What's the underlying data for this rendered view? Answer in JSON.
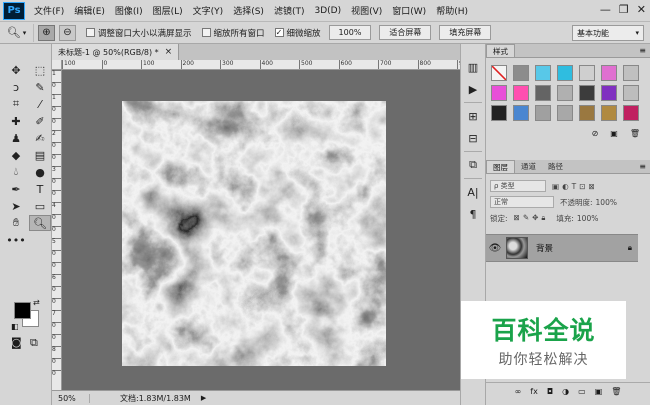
{
  "app": {
    "logo": "Ps"
  },
  "menu": [
    "文件(F)",
    "编辑(E)",
    "图像(I)",
    "图层(L)",
    "文字(Y)",
    "选择(S)",
    "滤镜(T)",
    "3D(D)",
    "视图(V)",
    "窗口(W)",
    "帮助(H)"
  ],
  "window_controls": {
    "minimize": "—",
    "restore": "❐",
    "close": "✕"
  },
  "options": {
    "tool_icon": "zoom-icon",
    "zoom_in": "⊕",
    "zoom_out": "⊖",
    "resize_windows": {
      "label": "调整窗口大小以满屏显示",
      "checked": false
    },
    "zoom_all": {
      "label": "缩放所有窗口",
      "checked": false
    },
    "scrubby_zoom": {
      "label": "细微缩放",
      "checked": true
    },
    "btn_100": "100%",
    "btn_fit": "适合屏幕",
    "btn_fill": "填充屏幕",
    "workspace": "基本功能"
  },
  "document": {
    "tab_title": "未标题-1 @ 50%(RGB/8) *",
    "tab_close": "×",
    "ruler_h": [
      "100",
      "0",
      "100",
      "200",
      "300",
      "400",
      "500",
      "600",
      "700",
      "800",
      "900"
    ],
    "ruler_v": [
      "1",
      "0",
      "1",
      "0",
      "0",
      "2",
      "0",
      "0",
      "3",
      "0",
      "0",
      "4",
      "0",
      "0",
      "5",
      "0",
      "0",
      "6",
      "0",
      "0",
      "7",
      "0",
      "0",
      "8",
      "0",
      "0"
    ],
    "status_zoom": "50%",
    "status_doc": "文档:1.83M/1.83M",
    "status_arrow": "▶"
  },
  "styles_panel": {
    "tab": "样式",
    "menu": "≡"
  },
  "styles_swatches": [
    "#f4f4f4",
    "#8c8c8c",
    "#58c8e8",
    "#2fbde0",
    "#cfcfcf",
    "#e070d0",
    "#c0c0c0",
    "#e84fd8",
    "#ff4fb0",
    "#646464",
    "#b0b0b0",
    "#3c3c3c",
    "#8030c0",
    "#bdbdbd",
    "#222222",
    "#4a86d0",
    "#a0a0a0",
    "#a8a8a8",
    "#9a7840",
    "#b08a40",
    "#c02060"
  ],
  "layers_panel": {
    "tabs": [
      "图层",
      "通道",
      "路径"
    ],
    "filter_kind": "ρ 类型",
    "blend_mode": "正常",
    "opacity_label": "不透明度:",
    "opacity_value": "100%",
    "lock_label": "锁定:",
    "fill_label": "填充:",
    "fill_value": "100%",
    "layer_name": "背景",
    "footer_icons": [
      "∞",
      "fx",
      "◘",
      "◑",
      "▭",
      "▣",
      "🗑"
    ]
  },
  "watermark": {
    "line1": "百科全说",
    "line2": "助你轻松解决"
  }
}
